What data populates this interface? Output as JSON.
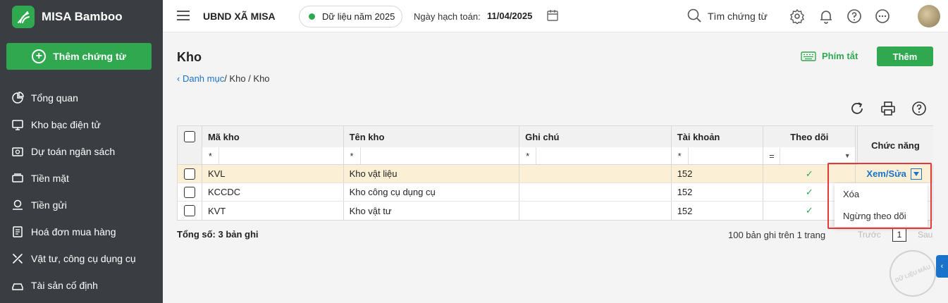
{
  "app": {
    "name": "MISA Bamboo",
    "add_button": "Thêm chứng từ"
  },
  "sidebar": {
    "items": [
      {
        "label": "Tổng quan",
        "icon": "pie-chart-icon"
      },
      {
        "label": "Kho bạc điện tử",
        "icon": "monitor-icon"
      },
      {
        "label": "Dự toán ngân sách",
        "icon": "budget-icon"
      },
      {
        "label": "Tiền mặt",
        "icon": "cash-icon"
      },
      {
        "label": "Tiền gửi",
        "icon": "deposit-icon"
      },
      {
        "label": "Hoá đơn mua hàng",
        "icon": "invoice-icon"
      },
      {
        "label": "Vật tư, công cụ dụng cụ",
        "icon": "tools-icon"
      },
      {
        "label": "Tài sản cố định",
        "icon": "asset-icon"
      }
    ]
  },
  "topbar": {
    "org": "UBND XÃ MISA",
    "year": "Dữ liệu năm 2025",
    "date_label": "Ngày hạch toán:",
    "date_value": "11/04/2025",
    "search_placeholder": "Tìm chứng từ"
  },
  "page": {
    "title": "Kho",
    "breadcrumb_link": "Danh mục",
    "breadcrumb_rest": " / Kho / Kho",
    "shortcut": "Phím tắt",
    "add": "Thêm"
  },
  "table": {
    "headers": {
      "ma": "Mã kho",
      "ten": "Tên kho",
      "ghichu": "Ghi chú",
      "taikhoan": "Tài khoản",
      "theodoi": "Theo dõi",
      "chucnang": "Chức năng"
    },
    "filter_ops": {
      "ma": "*",
      "ten": "*",
      "ghichu": "*",
      "taikhoan": "*",
      "theodoi": "="
    },
    "rows": [
      {
        "ma": "KVL",
        "ten": "Kho vật liệu",
        "ghichu": "",
        "taikhoan": "152",
        "theodoi": "✓",
        "selected": true
      },
      {
        "ma": "KCCDC",
        "ten": "Kho công cụ dụng cụ",
        "ghichu": "",
        "taikhoan": "152",
        "theodoi": "✓"
      },
      {
        "ma": "KVT",
        "ten": "Kho vật tư",
        "ghichu": "",
        "taikhoan": "152",
        "theodoi": "✓"
      }
    ],
    "action_label": "Xem/Sửa"
  },
  "dropdown": {
    "items": [
      "Xóa",
      "Ngừng theo dõi"
    ]
  },
  "footer": {
    "total": "Tổng số: 3 bản ghi",
    "paging": "100 bản ghi trên 1 trang",
    "prev": "Trước",
    "page_num": "1",
    "next": "Sau"
  },
  "watermark": "DỮ LIỆU MẪU"
}
